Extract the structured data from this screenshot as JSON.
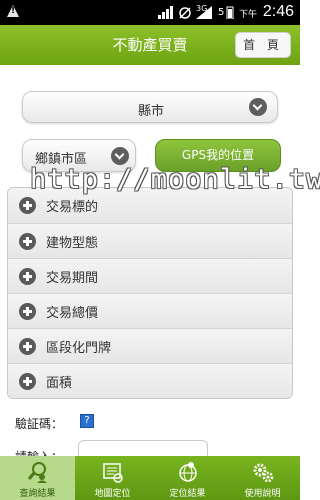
{
  "status_bar": {
    "network": "3G",
    "signal_label": "5",
    "ampm": "下午",
    "time": "2:46"
  },
  "header": {
    "title": "不動產買賣",
    "home_button": "首 頁"
  },
  "filters": {
    "county_select": "縣市",
    "township_select": "鄉鎮市區",
    "gps_button": "GPS我的位置"
  },
  "accordion": {
    "items": [
      {
        "label": "交易標的"
      },
      {
        "label": "建物型態"
      },
      {
        "label": "交易期間"
      },
      {
        "label": "交易總價"
      },
      {
        "label": "區段化門牌"
      },
      {
        "label": "面積"
      }
    ]
  },
  "captcha": {
    "label": "驗証碼：",
    "input_label": "請輸入："
  },
  "watermark": "http://moonlit.tw",
  "tabbar": {
    "tabs": [
      {
        "label": "查詢結果",
        "icon": "search-people-icon",
        "active": true
      },
      {
        "label": "地圖定位",
        "icon": "map-locate-icon",
        "active": false
      },
      {
        "label": "定位結果",
        "icon": "globe-pin-icon",
        "active": false
      },
      {
        "label": "使用說明",
        "icon": "gears-icon",
        "active": false
      }
    ]
  },
  "colors": {
    "brand_green": "#7cb51f",
    "active_tab": "#b6d98c"
  }
}
